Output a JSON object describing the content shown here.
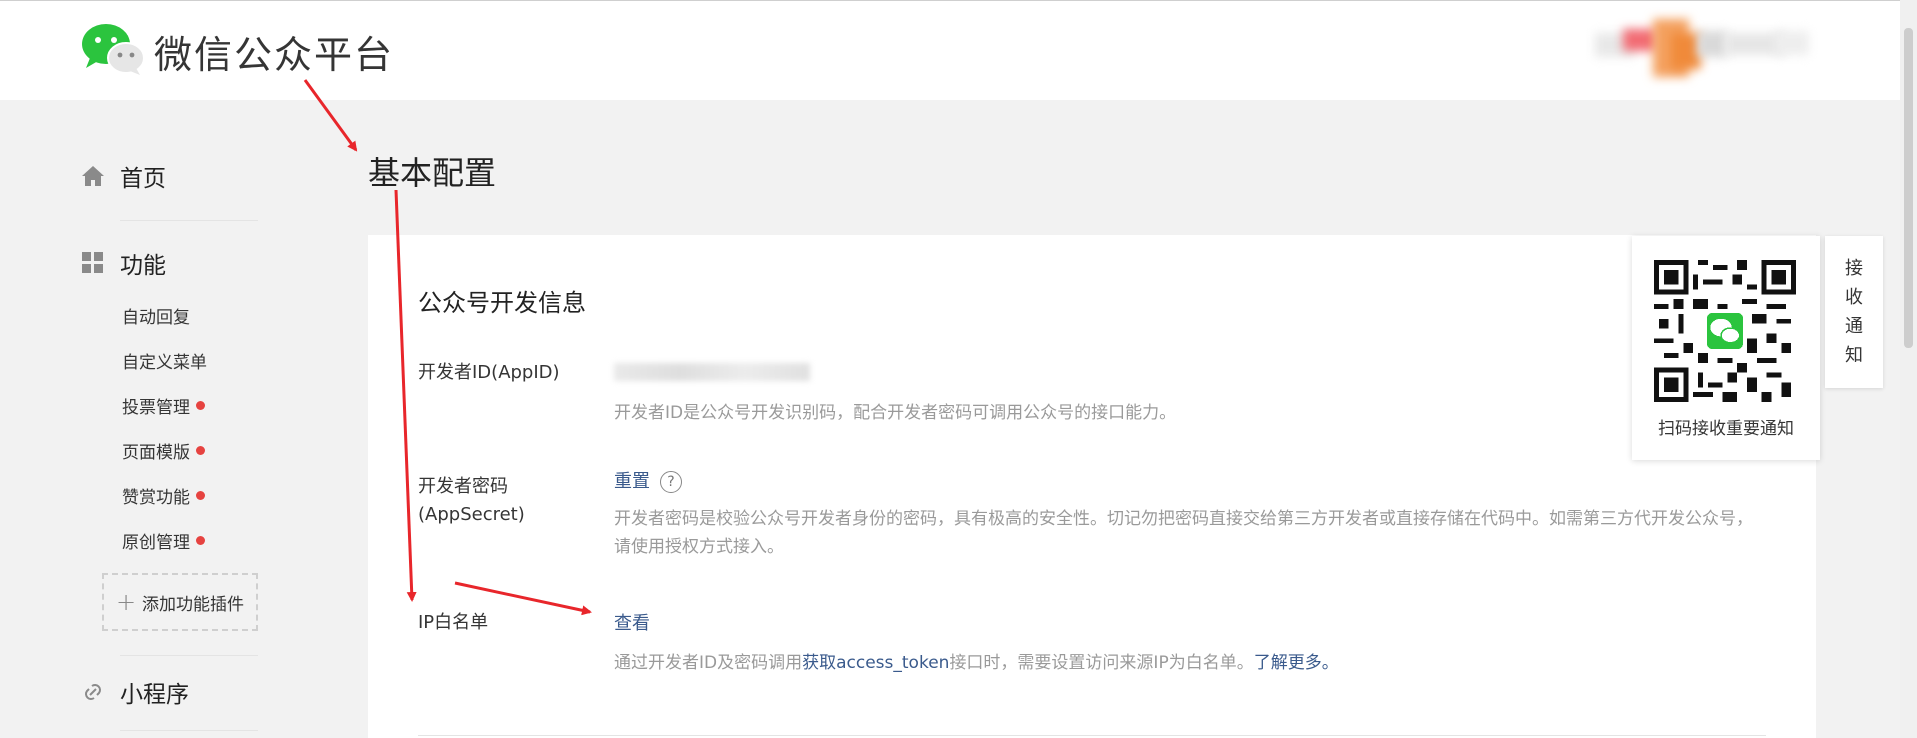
{
  "header": {
    "logo_text": "微信公众平台",
    "logo_icon": "wechat-logo-icon"
  },
  "sidebar": {
    "home": {
      "label": "首页",
      "icon": "home-icon"
    },
    "features": {
      "label": "功能",
      "icon": "grid-icon",
      "items": [
        {
          "label": "自动回复",
          "badge": false
        },
        {
          "label": "自定义菜单",
          "badge": false
        },
        {
          "label": "投票管理",
          "badge": true
        },
        {
          "label": "页面模版",
          "badge": true
        },
        {
          "label": "赞赏功能",
          "badge": true
        },
        {
          "label": "原创管理",
          "badge": true
        }
      ],
      "add_plugin": "添加功能插件"
    },
    "mini_program": {
      "label": "小程序",
      "icon": "link-icon"
    }
  },
  "page": {
    "title": "基本配置"
  },
  "dev_info": {
    "title": "公众号开发信息",
    "appid": {
      "label": "开发者ID(AppID)",
      "desc": "开发者ID是公众号开发识别码，配合开发者密码可调用公众号的接口能力。"
    },
    "secret": {
      "label_line1": "开发者密码",
      "label_line2": "(AppSecret)",
      "action": "重置",
      "help": "?",
      "desc": "开发者密码是校验公众号开发者身份的密码，具有极高的安全性。切记勿把密码直接交给第三方开发者或直接存储在代码中。如需第三方代开发公众号，请使用授权方式接入。"
    },
    "ip_whitelist": {
      "label": "IP白名单",
      "action": "查看",
      "desc_prefix": "通过开发者ID及密码调用",
      "desc_link": "获取access_token",
      "desc_middle": "接口时，需要设置访问来源IP为白名单。",
      "desc_learn_more": "了解更多。"
    }
  },
  "qr_panel": {
    "caption": "扫码接收重要通知",
    "tab_text": "接收通知"
  },
  "colors": {
    "link": "#3a5a8c",
    "badge": "#e64340",
    "annotation_arrow": "#e8262b",
    "wechat_green": "#2bc43e"
  }
}
